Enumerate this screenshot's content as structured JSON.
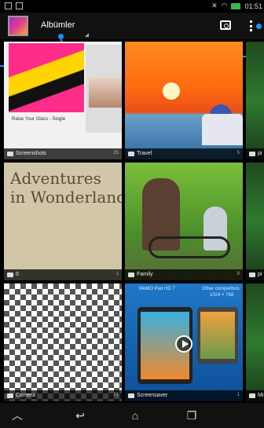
{
  "status_bar": {
    "time": "01:51"
  },
  "action_bar": {
    "title": "Albümler",
    "icons": {
      "app": "gallery-app-icon",
      "camera": "camera-icon",
      "more": "overflow-menu-icon"
    }
  },
  "albums": [
    {
      "name": "Screenshots",
      "count": "26",
      "thumb_text_1": "Raise Your Glass - Single",
      "thumb_text_2": ""
    },
    {
      "name": "Travel",
      "count": "5"
    },
    {
      "name": "pi",
      "count": ""
    },
    {
      "name": "0",
      "count": "1",
      "thumb_text_1": "Adventures",
      "thumb_text_2": "in Wonderland"
    },
    {
      "name": "Family",
      "count": "8"
    },
    {
      "name": "pi",
      "count": ""
    },
    {
      "name": "Camera",
      "count": "21"
    },
    {
      "name": "Screensaver",
      "count": "1",
      "thumb_text_1": "MeMO Pad HD 7",
      "thumb_text_2": "Other competitors",
      "thumb_text_3": "1024 × 768"
    },
    {
      "name": "Mi",
      "count": ""
    }
  ],
  "nav": {
    "back": "back-icon",
    "home": "home-icon",
    "recent": "recent-apps-icon",
    "up": "hide-bar-icon"
  },
  "colors": {
    "callout": "#1e90ff",
    "battery": "#3fb34f"
  }
}
